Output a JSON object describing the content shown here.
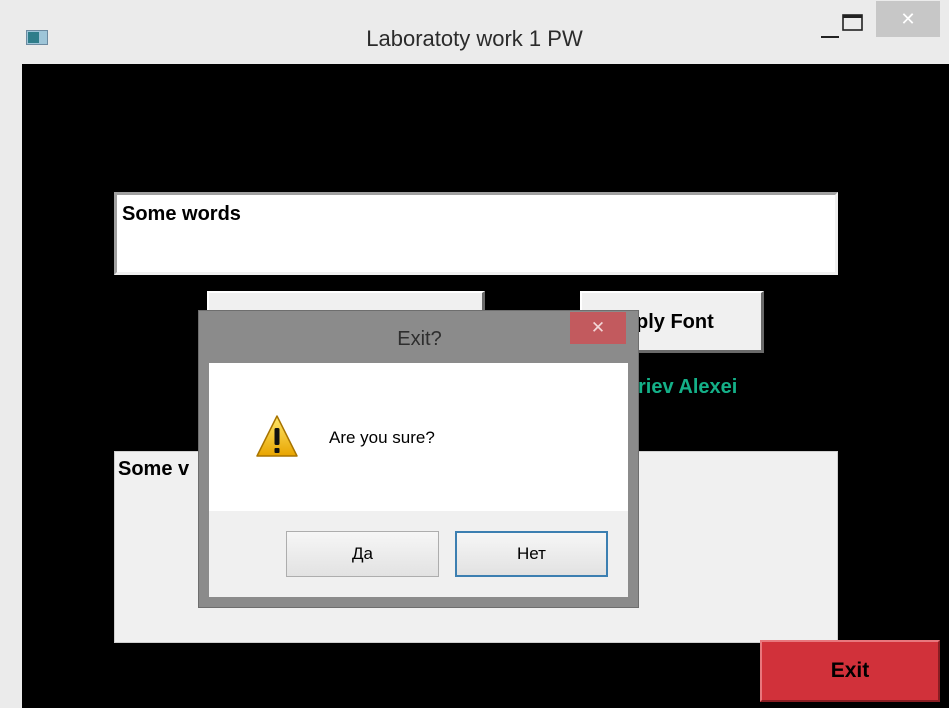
{
  "window": {
    "title": "Laboratoty work 1 PW",
    "close_glyph": "✕",
    "icons": [
      "app-icon",
      "minimize-icon",
      "maximize-icon",
      "close-icon"
    ]
  },
  "main": {
    "input_text": "Some words",
    "apply_button_partial": "ply Font",
    "author_partial": "riev Alexei",
    "output_partial": "Some v",
    "exit_label": "Exit"
  },
  "dialog": {
    "title": "Exit?",
    "close_glyph": "✕",
    "message": "Are you sure?",
    "yes_label": "Да",
    "no_label": "Нет",
    "icon": "warning-icon"
  },
  "colors": {
    "client_background": "#000000",
    "author_text": "#14b088",
    "exit_button": "#d1313a",
    "dialog_close": "#c25a5e",
    "default_button_border": "#3c7fb1"
  }
}
